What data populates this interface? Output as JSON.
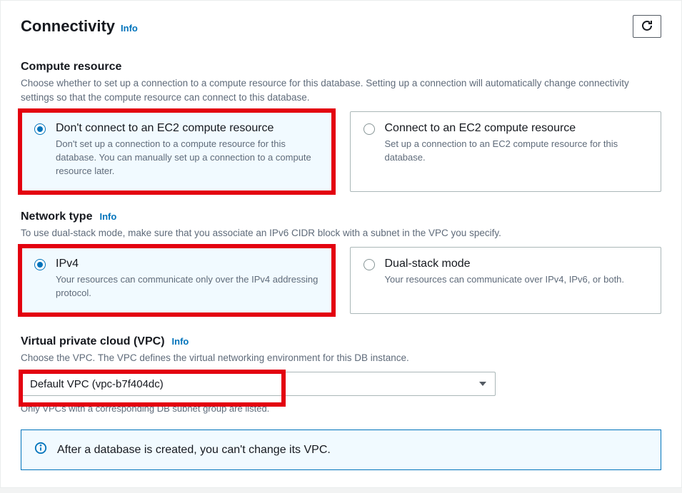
{
  "header": {
    "title": "Connectivity",
    "info": "Info"
  },
  "compute": {
    "heading": "Compute resource",
    "desc": "Choose whether to set up a connection to a compute resource for this database. Setting up a connection will automatically change connectivity settings so that the compute resource can connect to this database.",
    "opt1": {
      "label": "Don't connect to an EC2 compute resource",
      "sub": "Don't set up a connection to a compute resource for this database. You can manually set up a connection to a compute resource later."
    },
    "opt2": {
      "label": "Connect to an EC2 compute resource",
      "sub": "Set up a connection to an EC2 compute resource for this database."
    }
  },
  "network": {
    "heading": "Network type",
    "info": "Info",
    "desc": "To use dual-stack mode, make sure that you associate an IPv6 CIDR block with a subnet in the VPC you specify.",
    "opt1": {
      "label": "IPv4",
      "sub": "Your resources can communicate only over the IPv4 addressing protocol."
    },
    "opt2": {
      "label": "Dual-stack mode",
      "sub": "Your resources can communicate over IPv4, IPv6, or both."
    }
  },
  "vpc": {
    "heading": "Virtual private cloud (VPC)",
    "info": "Info",
    "desc": "Choose the VPC. The VPC defines the virtual networking environment for this DB instance.",
    "selected": "Default VPC (vpc-b7f404dc)",
    "hint": "Only VPCs with a corresponding DB subnet group are listed."
  },
  "alert": {
    "text": "After a database is created, you can't change its VPC."
  }
}
